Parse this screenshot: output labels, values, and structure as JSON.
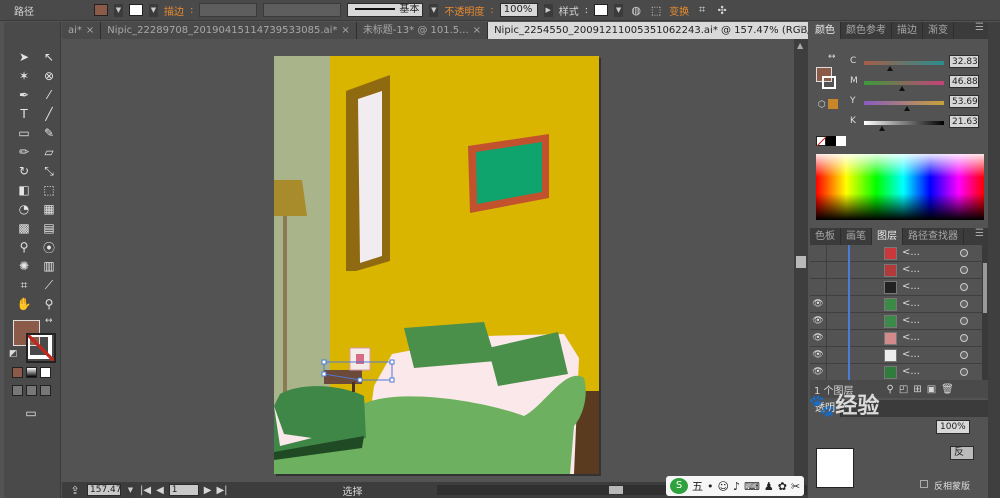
{
  "topbar": {
    "path_label": "路径",
    "stroke_label": "描边",
    "stroke_sep": ":",
    "stroke_style": "基本",
    "opacity_label": "不透明度",
    "opacity_sep": ":",
    "opacity_value": "100%",
    "style_label": "样式",
    "style_sep": ":",
    "transform_label": "变换"
  },
  "tabs": [
    {
      "label": "ai*",
      "close": "×"
    },
    {
      "label": "Nipic_22289708_20190415114739533085.ai*",
      "close": "×"
    },
    {
      "label": "未标题-13* @ 101.5...",
      "close": "×"
    },
    {
      "label": "Nipic_2254550_20091211005351062243.ai* @ 157.47% (RGB/预览)",
      "close": "×"
    }
  ],
  "tabs_overflow": "»",
  "status": {
    "zoom": "157.47",
    "page": "1",
    "tool": "选择"
  },
  "color_panel": {
    "tabs": [
      "颜色",
      "颜色参考",
      "描边",
      "渐变"
    ],
    "sliders": [
      {
        "letter": "C",
        "value": "32.83",
        "fraction": 0.33,
        "gradient": "linear-gradient(to right,#a55e48,#2a8d8d)"
      },
      {
        "letter": "M",
        "value": "46.88",
        "fraction": 0.47,
        "gradient": "linear-gradient(to right,#3c9a3a,#c8417a)"
      },
      {
        "letter": "Y",
        "value": "53.69",
        "fraction": 0.54,
        "gradient": "linear-gradient(to right,#8a5ac0,#c6a23a)"
      },
      {
        "letter": "K",
        "value": "21.63",
        "fraction": 0.22,
        "gradient": "linear-gradient(to right,#fff,#000)"
      }
    ],
    "fill_color": "#8b5a48"
  },
  "layers_panel": {
    "tabs": [
      "色板",
      "画笔",
      "图层",
      "路径查找器"
    ],
    "rows": [
      {
        "eye": "",
        "thumb": "#c9383a",
        "label": "<..."
      },
      {
        "eye": "",
        "thumb": "#b23a3a",
        "label": "<..."
      },
      {
        "eye": "",
        "thumb": "#222",
        "label": "<..."
      },
      {
        "eye": "👁",
        "thumb": "#3d8a46",
        "label": "<..."
      },
      {
        "eye": "👁",
        "thumb": "#3b8a4a",
        "label": "<..."
      },
      {
        "eye": "👁",
        "thumb": "#d28a8a",
        "label": "<..."
      },
      {
        "eye": "👁",
        "thumb": "#eee",
        "label": "<..."
      },
      {
        "eye": "👁",
        "thumb": "#2f7c3c",
        "label": "<..."
      }
    ],
    "count": "1 个图层"
  },
  "transparency": {
    "tab": "透明",
    "opacity": "100%",
    "btn": "反",
    "invert_label": "反相蒙版"
  },
  "watermark": "经验",
  "ime": {
    "mode": "五",
    "dot": "•"
  },
  "colors": {
    "wall_left": "#a9b48a",
    "wall": "#d9b500",
    "frame": "#c2522e",
    "picture": "#0fa36d",
    "window_frame": "#8f6a10",
    "window_glass": "#f1ecf0",
    "lamp": "#a88b2b",
    "sheet": "#fbe8ea",
    "blanket": "#6db05f",
    "pillow": "#4a8f4a",
    "dark": "#5a3b1f"
  }
}
